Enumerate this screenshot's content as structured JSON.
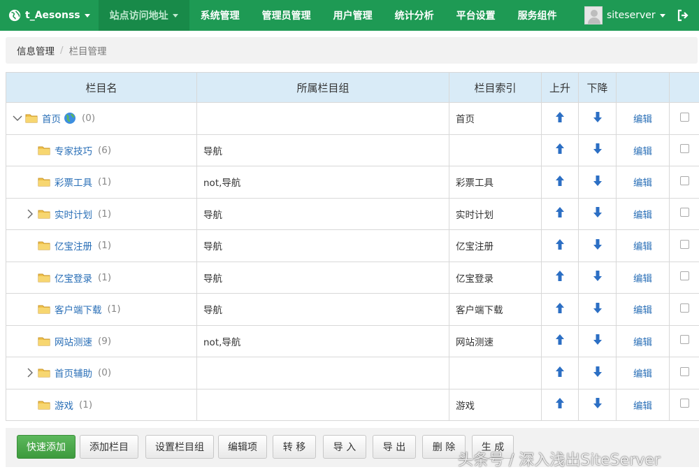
{
  "nav": {
    "site": "t_Aesonss",
    "items": [
      "站点访问地址",
      "系统管理",
      "管理员管理",
      "用户管理",
      "统计分析",
      "平台设置",
      "服务组件"
    ],
    "user": "siteserver"
  },
  "breadcrumb": {
    "parent": "信息管理",
    "sep": "/",
    "current": "栏目管理"
  },
  "table": {
    "headers": [
      "栏目名",
      "所属栏目组",
      "栏目索引",
      "上升",
      "下降",
      "",
      ""
    ],
    "rows": [
      {
        "name": "首页",
        "count": "(0)",
        "group": "",
        "index": "首页",
        "edit": "编辑",
        "toggle": "open",
        "root": true
      },
      {
        "name": "专家技巧",
        "count": "(6)",
        "group": "导航",
        "index": "",
        "edit": "编辑",
        "toggle": "none"
      },
      {
        "name": "彩票工具",
        "count": "(1)",
        "group": "not,导航",
        "index": "彩票工具",
        "edit": "编辑",
        "toggle": "none"
      },
      {
        "name": "实时计划",
        "count": "(1)",
        "group": "导航",
        "index": "实时计划",
        "edit": "编辑",
        "toggle": "closed"
      },
      {
        "name": "亿宝注册",
        "count": "(1)",
        "group": "导航",
        "index": "亿宝注册",
        "edit": "编辑",
        "toggle": "none"
      },
      {
        "name": "亿宝登录",
        "count": "(1)",
        "group": "导航",
        "index": "亿宝登录",
        "edit": "编辑",
        "toggle": "none"
      },
      {
        "name": "客户端下载",
        "count": "(1)",
        "group": "导航",
        "index": "客户端下载",
        "edit": "编辑",
        "toggle": "none"
      },
      {
        "name": "网站测速",
        "count": "(9)",
        "group": "not,导航",
        "index": "网站测速",
        "edit": "编辑",
        "toggle": "none"
      },
      {
        "name": "首页辅助",
        "count": "(0)",
        "group": "",
        "index": "",
        "edit": "编辑",
        "toggle": "closed"
      },
      {
        "name": "游戏",
        "count": "(1)",
        "group": "",
        "index": "游戏",
        "edit": "编辑",
        "toggle": "none"
      }
    ]
  },
  "toolbar": {
    "quick_add": "快速添加",
    "add": "添加栏目",
    "set_group": "设置栏目组",
    "edit_items": "编辑项",
    "move": "转 移",
    "import": "导 入",
    "export": "导 出",
    "delete": "删 除",
    "generate": "生 成"
  },
  "watermark": "头条号 / 深入浅出SiteServer",
  "colors": {
    "nav": "#1e9a54",
    "header": "#d9ebf7",
    "link": "#2a6fb7",
    "primary": "#5cb85c"
  }
}
